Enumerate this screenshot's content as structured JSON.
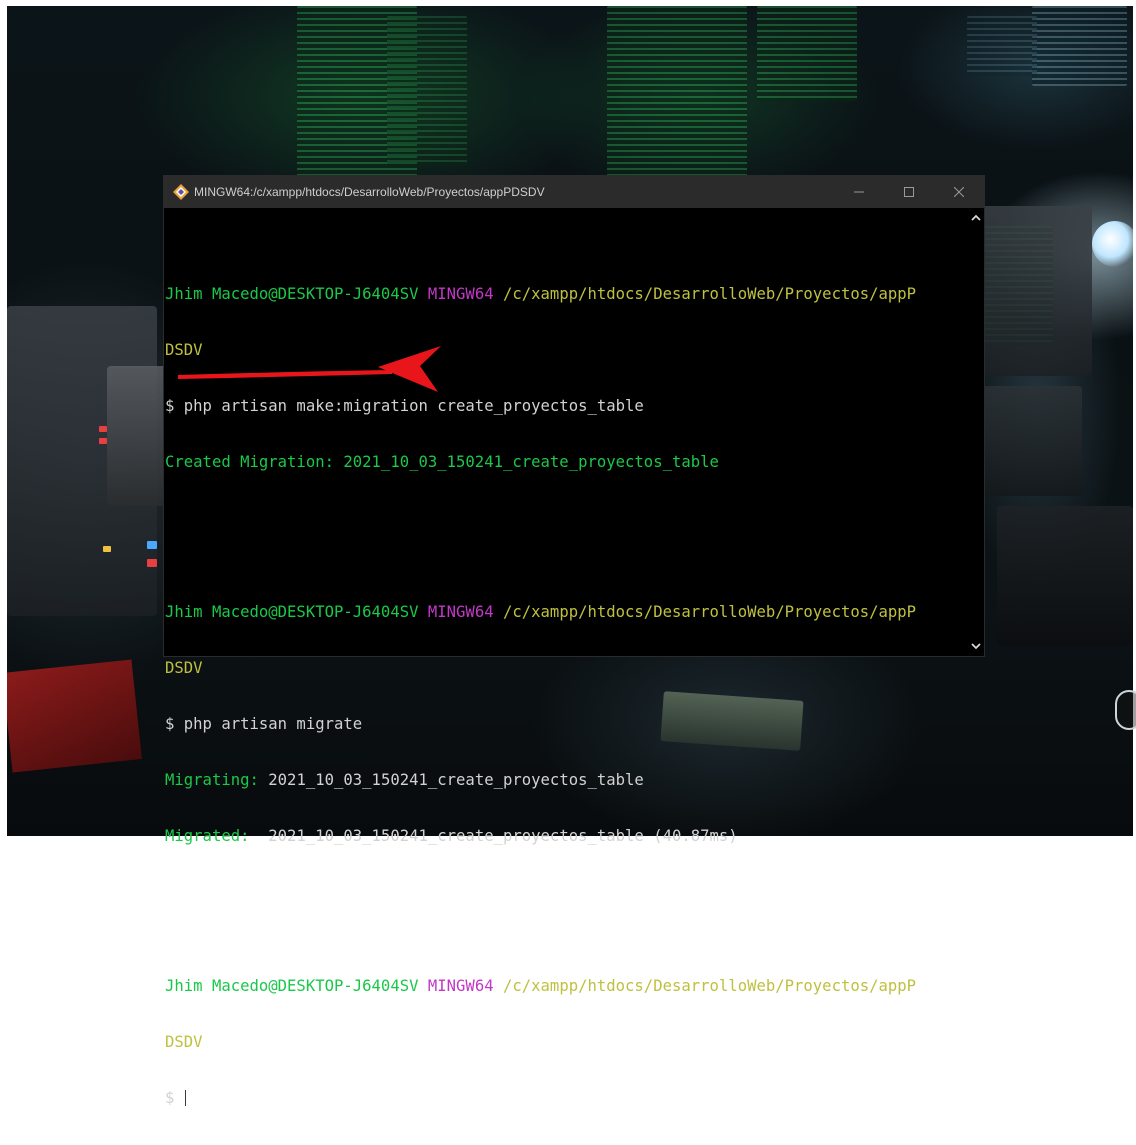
{
  "window": {
    "title": "MINGW64:/c/xampp/htdocs/DesarrolloWeb/Proyectos/appPDSDV",
    "icon": "git-bash-icon",
    "controls": [
      "minimize-icon",
      "maximize-icon",
      "close-icon"
    ]
  },
  "terminal": {
    "blocks": [
      {
        "prompt_user": "Jhim Macedo@DESKTOP-J6404SV",
        "prompt_env": "MINGW64",
        "prompt_path": "/c/xampp/htdocs/DesarrolloWeb/Proyectos/appP",
        "prompt_path_cont": "DSDV",
        "command": "$ php artisan make:migration create_proyectos_table",
        "output": [
          "Created Migration: 2021_10_03_150241_create_proyectos_table"
        ]
      },
      {
        "prompt_user": "Jhim Macedo@DESKTOP-J6404SV",
        "prompt_env": "MINGW64",
        "prompt_path": "/c/xampp/htdocs/DesarrolloWeb/Proyectos/appP",
        "prompt_path_cont": "DSDV",
        "command": "$ php artisan migrate",
        "output_labels": [
          "Migrating:",
          "Migrated:"
        ],
        "output_values": [
          "2021_10_03_150241_create_proyectos_table",
          "2021_10_03_150241_create_proyectos_table (40.87ms)"
        ]
      },
      {
        "prompt_user": "Jhim Macedo@DESKTOP-J6404SV",
        "prompt_env": "MINGW64",
        "prompt_path": "/c/xampp/htdocs/DesarrolloWeb/Proyectos/appP",
        "prompt_path_cont": "DSDV",
        "command": "$"
      }
    ]
  },
  "annotation": {
    "type": "red-arrow-underline",
    "color": "#e8161b",
    "target": "$ php artisan migrate"
  },
  "colors": {
    "user": "#1bc84a",
    "env": "#c238c8",
    "path": "#c0c040",
    "text": "#d2d2d2",
    "titlebar": "#2b2b2b"
  }
}
